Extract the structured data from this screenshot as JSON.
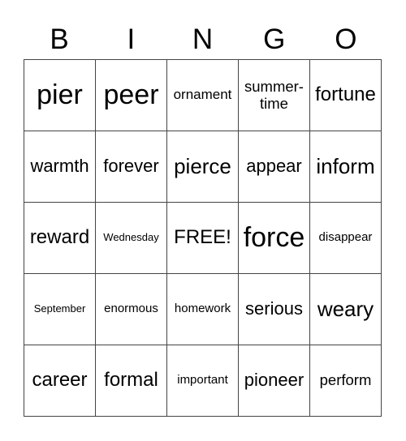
{
  "header": [
    "B",
    "I",
    "N",
    "G",
    "O"
  ],
  "rows": [
    [
      "pier",
      "peer",
      "ornament",
      "summer-\ntime",
      "fortune"
    ],
    [
      "warmth",
      "forever",
      "pierce",
      "appear",
      "inform"
    ],
    [
      "reward",
      "Wednesday",
      "FREE!",
      "force",
      "disappear"
    ],
    [
      "September",
      "enormous",
      "homework",
      "serious",
      "weary"
    ],
    [
      "career",
      "formal",
      "important",
      "pioneer",
      "perform"
    ]
  ]
}
